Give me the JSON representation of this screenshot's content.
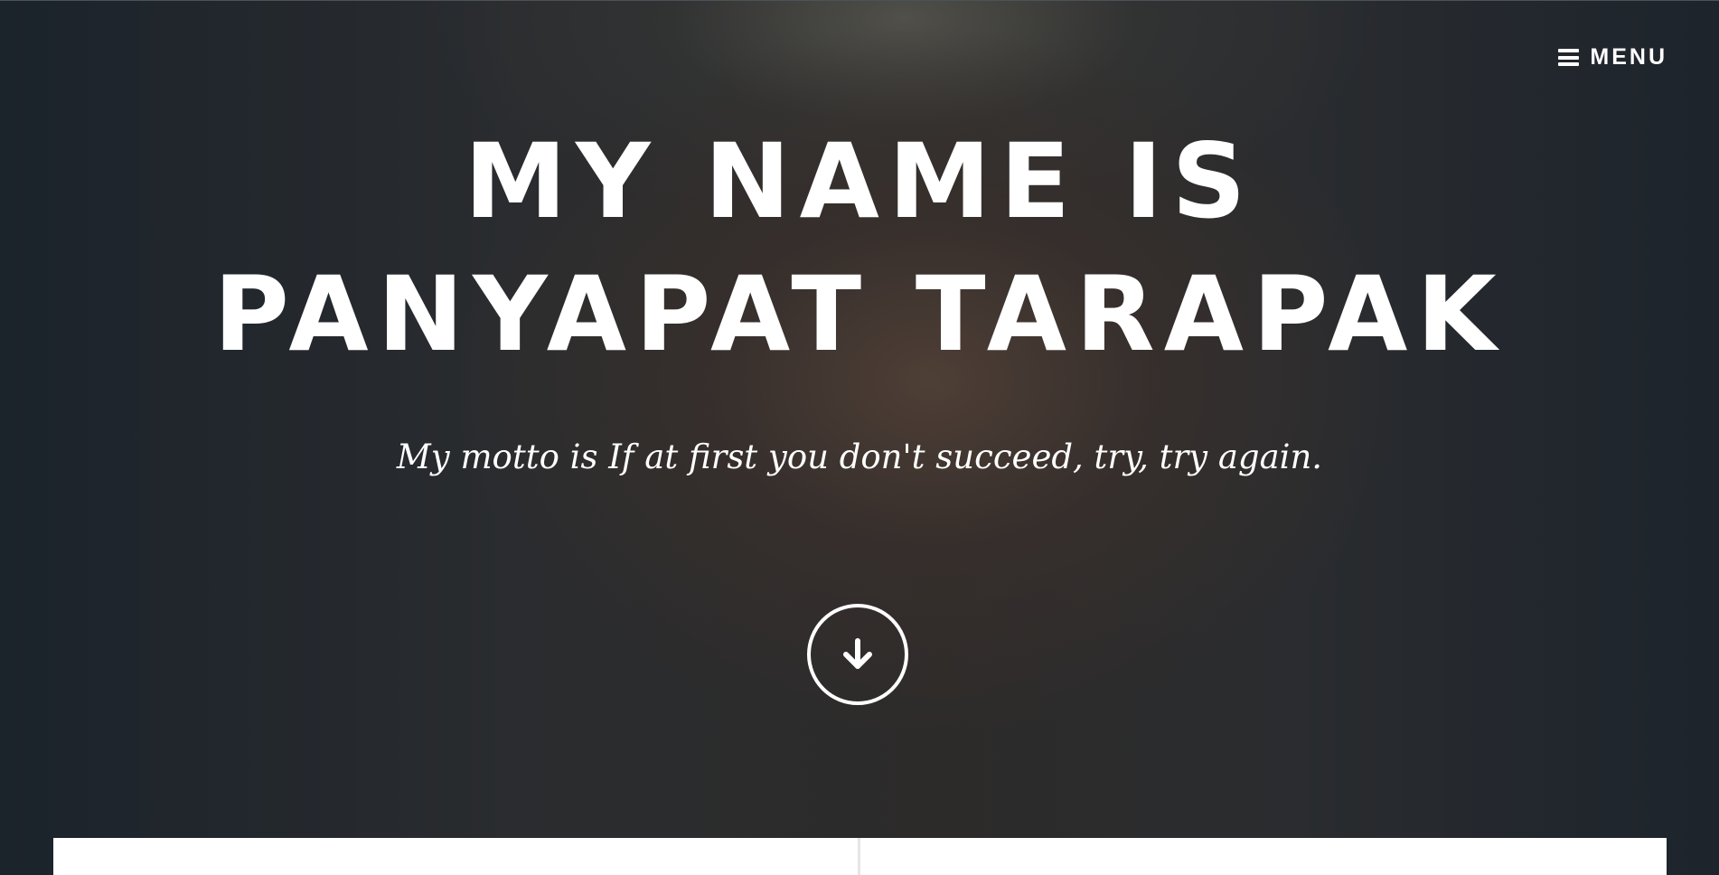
{
  "header": {
    "menu_label": "MENU",
    "menu_icon": "hamburger-icon"
  },
  "hero": {
    "title_line1": "MY NAME IS",
    "title_line2": "PANYAPAT TARAPAK",
    "motto": "My motto is If at first you don't succeed, try, try again.",
    "scroll_icon": "arrow-down-icon"
  },
  "colors": {
    "text": "#ffffff",
    "background_dark": "#1f2329",
    "card": "#ffffff"
  }
}
